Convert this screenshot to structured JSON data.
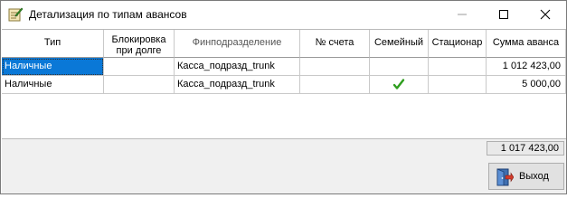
{
  "window": {
    "title": "Детализация по типам авансов",
    "controls": [
      "minimize",
      "maximize",
      "close"
    ]
  },
  "grid": {
    "columns": [
      "Тип",
      "Блокировка при долге",
      "Финподразделение",
      "№ счета",
      "Семейный",
      "Стационар",
      "Сумма аванса"
    ],
    "rows": [
      {
        "type": "Наличные",
        "lock": "",
        "division": "Касса_подразд_trunk",
        "account": "",
        "family": "",
        "stationary": "",
        "amount": "1 012 423,00"
      },
      {
        "type": "Наличные",
        "lock": "",
        "division": "Касса_подразд_trunk",
        "account": "",
        "family": "checked",
        "stationary": "",
        "amount": "5 000,00"
      }
    ],
    "total": "1 017 423,00"
  },
  "buttons": {
    "exit": "Выход"
  },
  "colors": {
    "selection": "#0a78d7",
    "check": "#2e9e1e"
  }
}
